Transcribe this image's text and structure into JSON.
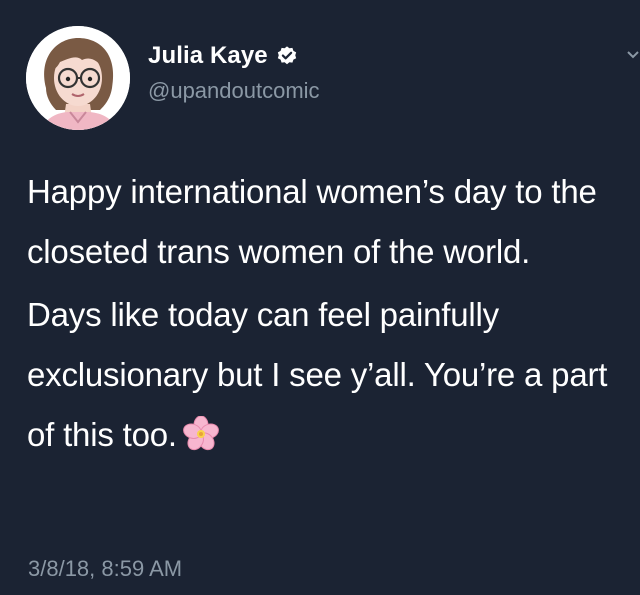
{
  "tweet": {
    "author": {
      "display_name": "Julia Kaye",
      "handle": "@upandoutcomic",
      "verified": true,
      "avatar_icon": "cartoon-avatar"
    },
    "paragraph_1": "Happy international women’s day to the closeted trans women of the world.",
    "paragraph_2": "Days like today can feel painfully exclusionary but I see y’all. You’re a part of this too.",
    "emoji": "cherry-blossom",
    "timestamp": "3/8/18, 8:59 AM"
  },
  "colors": {
    "background": "#1b2333",
    "text": "#ffffff",
    "secondary_text": "#8b98a5",
    "verified_badge": "#ffffff"
  }
}
